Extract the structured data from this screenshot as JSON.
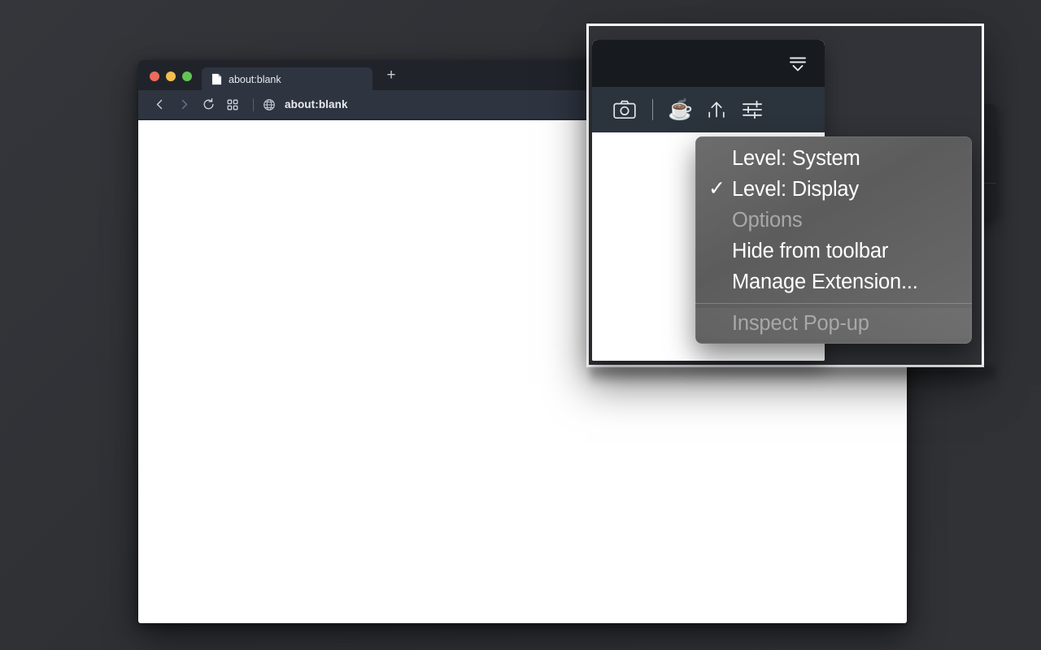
{
  "browser": {
    "window_controls": [
      {
        "name": "close",
        "color": "#ed6a5f"
      },
      {
        "name": "minimize",
        "color": "#f4bd4f"
      },
      {
        "name": "maximize",
        "color": "#61c554"
      }
    ],
    "tabs": [
      {
        "title": "about:blank",
        "icon": "document-icon",
        "active": true
      }
    ],
    "new_tab_label": "+",
    "nav": {
      "back_icon": "chevron-left-icon",
      "forward_icon": "chevron-right-icon",
      "reload_icon": "reload-icon",
      "apps_icon": "grid-apps-icon",
      "site_icon": "globe-icon",
      "url": "about:blank"
    }
  },
  "extension_popup": {
    "collapse_icon": "collapse-panel-icon",
    "toolbar": [
      {
        "id": "screenshot",
        "icon": "camera-icon",
        "label": "Screenshot"
      },
      {
        "id": "separator",
        "icon": "divider",
        "label": ""
      },
      {
        "id": "coffee",
        "icon": "coffee-cup-icon",
        "label": "☕"
      },
      {
        "id": "share",
        "icon": "upload-arrow-icon",
        "label": "Share"
      },
      {
        "id": "settings",
        "icon": "sliders-icon",
        "label": "Settings"
      }
    ]
  },
  "context_menu": {
    "items": [
      {
        "label": "Level: System",
        "checked": false,
        "disabled": false
      },
      {
        "label": "Level: Display",
        "checked": true,
        "disabled": false
      },
      {
        "label": "Options",
        "checked": false,
        "disabled": true
      },
      {
        "label": "Hide from toolbar",
        "checked": false,
        "disabled": false
      },
      {
        "label": "Manage Extension...",
        "checked": false,
        "disabled": false
      }
    ],
    "footer_items": [
      {
        "label": "Inspect Pop-up",
        "checked": false,
        "disabled": true
      }
    ],
    "check_glyph": "✓"
  },
  "colors": {
    "desktop_bg": "#2f3136",
    "tabstrip": "#20242a",
    "navbar": "#2e3440",
    "popup_header": "#171a1f",
    "popup_toolbar": "#2b333c",
    "menu_bg": "#5c5c5c",
    "accent_white": "#ffffff"
  }
}
